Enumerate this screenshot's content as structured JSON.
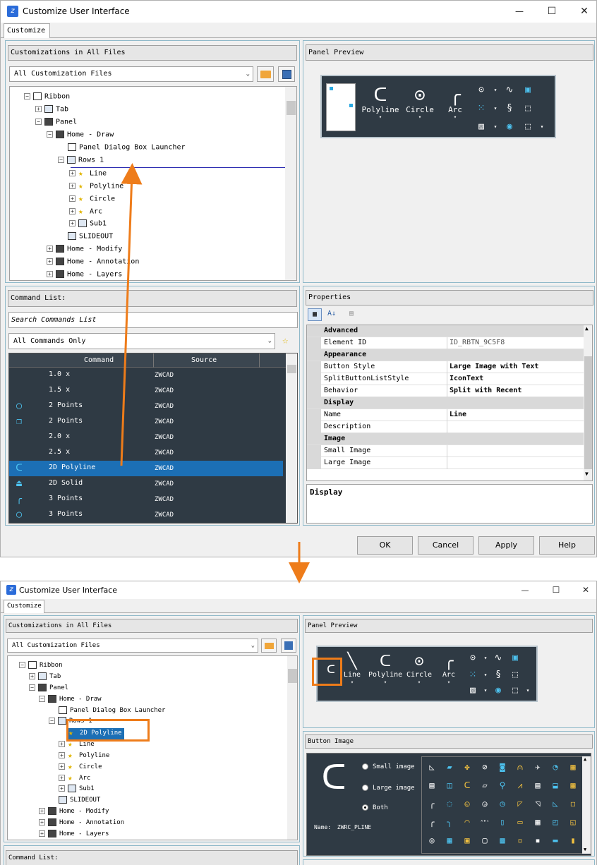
{
  "colors": {
    "accent_orange": "#ee7c1a",
    "dark_panel": "#2f3a44",
    "selection_blue": "#1c6fb5",
    "icon_blue": "#4dc3f0"
  },
  "window_title": "Customize User Interface",
  "customize_tab": "Customize",
  "window_controls": {
    "minimize": "—",
    "maximize": "☐",
    "close": "✕"
  },
  "customizations": {
    "header": "Customizations in All Files",
    "files_combo": "All Customization Files"
  },
  "tree_top": {
    "items": [
      {
        "label": "Ribbon",
        "icon": "ribbon-icon"
      },
      {
        "label": "Tab",
        "icon": "tab-icon"
      },
      {
        "label": "Panel",
        "icon": "panel-icon"
      },
      {
        "label": "Home - Draw",
        "icon": "panel-icon"
      },
      {
        "label": "Panel Dialog Box Launcher",
        "icon": "dialog-launcher-icon"
      },
      {
        "label": "Rows 1",
        "icon": "rows-icon"
      },
      {
        "label": "Line",
        "icon": "star-icon"
      },
      {
        "label": "Polyline",
        "icon": "star-icon"
      },
      {
        "label": "Circle",
        "icon": "star-icon"
      },
      {
        "label": "Arc",
        "icon": "star-icon"
      },
      {
        "label": "Sub1",
        "icon": "rows-icon"
      },
      {
        "label": "SLIDEOUT",
        "icon": "slideout-icon"
      },
      {
        "label": "Home - Modify",
        "icon": "panel-icon"
      },
      {
        "label": "Home - Annotation",
        "icon": "panel-icon"
      },
      {
        "label": "Home - Layers",
        "icon": "panel-icon"
      }
    ]
  },
  "command_list": {
    "header": "Command List:",
    "search_placeholder": "Search Commands List",
    "filter_combo": "All Commands Only",
    "col_command": "Command",
    "col_source": "Source",
    "rows": [
      {
        "name": "1.0 x",
        "source": "ZWCAD",
        "icon": ""
      },
      {
        "name": "1.5 x",
        "source": "ZWCAD",
        "icon": ""
      },
      {
        "name": "2 Points",
        "source": "ZWCAD",
        "icon": "◯"
      },
      {
        "name": "2 Points",
        "source": "ZWCAD",
        "icon": "❐"
      },
      {
        "name": "2.0 x",
        "source": "ZWCAD",
        "icon": ""
      },
      {
        "name": "2.5 x",
        "source": "ZWCAD",
        "icon": ""
      },
      {
        "name": "2D Polyline",
        "source": "ZWCAD",
        "icon": "ᑕ"
      },
      {
        "name": "2D Solid",
        "source": "ZWCAD",
        "icon": "⏏"
      },
      {
        "name": "3 Points",
        "source": "ZWCAD",
        "icon": "╭"
      },
      {
        "name": "3 Points",
        "source": "ZWCAD",
        "icon": "◯"
      }
    ]
  },
  "panel_preview": {
    "header": "Panel Preview",
    "buttons_top": [
      {
        "label": "Polyline",
        "glyph": "ᑕ"
      },
      {
        "label": "Circle",
        "glyph": "⊙"
      },
      {
        "label": "Arc",
        "glyph": "╭"
      }
    ],
    "buttons_bottom": [
      {
        "label": "Line",
        "glyph": "╲"
      },
      {
        "label": "Polyline",
        "glyph": "ᑕ"
      },
      {
        "label": "Circle",
        "glyph": "⊙"
      },
      {
        "label": "Arc",
        "glyph": "╭"
      }
    ],
    "dropdown_arrow": "▾"
  },
  "properties": {
    "header": "Properties",
    "rows": [
      {
        "type": "cat",
        "key": "Advanced"
      },
      {
        "type": "prop",
        "key": "Element ID",
        "value": "ID_RBTN_9C5F8",
        "plain": true
      },
      {
        "type": "cat",
        "key": "Appearance"
      },
      {
        "type": "prop",
        "key": "Button Style",
        "value": "Large Image with Text"
      },
      {
        "type": "prop",
        "key": "SplitButtonListStyle",
        "value": "IconText"
      },
      {
        "type": "prop",
        "key": "Behavior",
        "value": "Split with Recent"
      },
      {
        "type": "cat",
        "key": "Display"
      },
      {
        "type": "prop",
        "key": "Name",
        "value": "Line"
      },
      {
        "type": "prop",
        "key": "Description",
        "value": ""
      },
      {
        "type": "cat",
        "key": "Image"
      },
      {
        "type": "prop",
        "key": "Small Image",
        "value": ""
      },
      {
        "type": "prop",
        "key": "Large Image",
        "value": ""
      }
    ],
    "description_title": "Display"
  },
  "buttons": {
    "ok": "OK",
    "cancel": "Cancel",
    "apply": "Apply",
    "help": "Help"
  },
  "tree_bottom": {
    "items": [
      {
        "label": "Ribbon"
      },
      {
        "label": "Tab"
      },
      {
        "label": "Panel"
      },
      {
        "label": "Home - Draw"
      },
      {
        "label": "Panel Dialog Box Launcher"
      },
      {
        "label": "Rows 1"
      },
      {
        "label": "2D Polyline"
      },
      {
        "label": "Line"
      },
      {
        "label": "Polyline"
      },
      {
        "label": "Circle"
      },
      {
        "label": "Arc"
      },
      {
        "label": "Sub1"
      },
      {
        "label": "SLIDEOUT"
      },
      {
        "label": "Home - Modify"
      },
      {
        "label": "Home - Annotation"
      },
      {
        "label": "Home - Layers"
      }
    ]
  },
  "button_image": {
    "header": "Button Image",
    "small_image": "Small image",
    "large_image": "Large image",
    "both": "Both",
    "name_label": "Name:",
    "name_value": "ZWRC_PLINE",
    "preview_glyph": "ᑕ",
    "grid_glyphs": [
      "◺",
      "▰",
      "✤",
      "⊘",
      "◙",
      "⩀",
      "✈",
      "◔",
      "▦",
      "▤",
      "◫",
      "ᑕ",
      "▱",
      "⚲",
      "⩘",
      "▤",
      "⬓",
      "▦",
      "╭",
      "◌",
      "◵",
      "◶",
      "◷",
      "◸",
      "◹",
      "◺",
      "◻",
      "╭",
      "╮",
      "◠",
      "ᴬᴮᶜ",
      "▯",
      "▭",
      "▦",
      "◰",
      "◱",
      "◎",
      "▦",
      "▣",
      "▢",
      "▩",
      "▫",
      "▪",
      "▬",
      "▮"
    ]
  }
}
